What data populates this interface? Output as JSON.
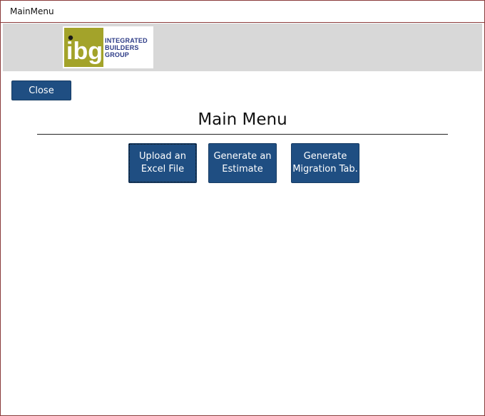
{
  "window": {
    "title": "MainMenu"
  },
  "logo": {
    "mark": "ibg",
    "lines": [
      "INTEGRATED",
      "BUILDERS",
      "GROUP"
    ],
    "colors": {
      "mark_bg": "#a3a32a",
      "text": "#2b3a86"
    }
  },
  "toolbar": {
    "close_label": "Close"
  },
  "main": {
    "title": "Main Menu",
    "buttons": [
      {
        "line1": "Upload an",
        "line2": "Excel File"
      },
      {
        "line1": "Generate an",
        "line2": "Estimate"
      },
      {
        "line1": "Generate",
        "line2": "Migration Tab."
      }
    ]
  },
  "colors": {
    "button": "#1f4e82",
    "header_band": "#d8d8d8",
    "window_border": "#8a3a3a"
  }
}
